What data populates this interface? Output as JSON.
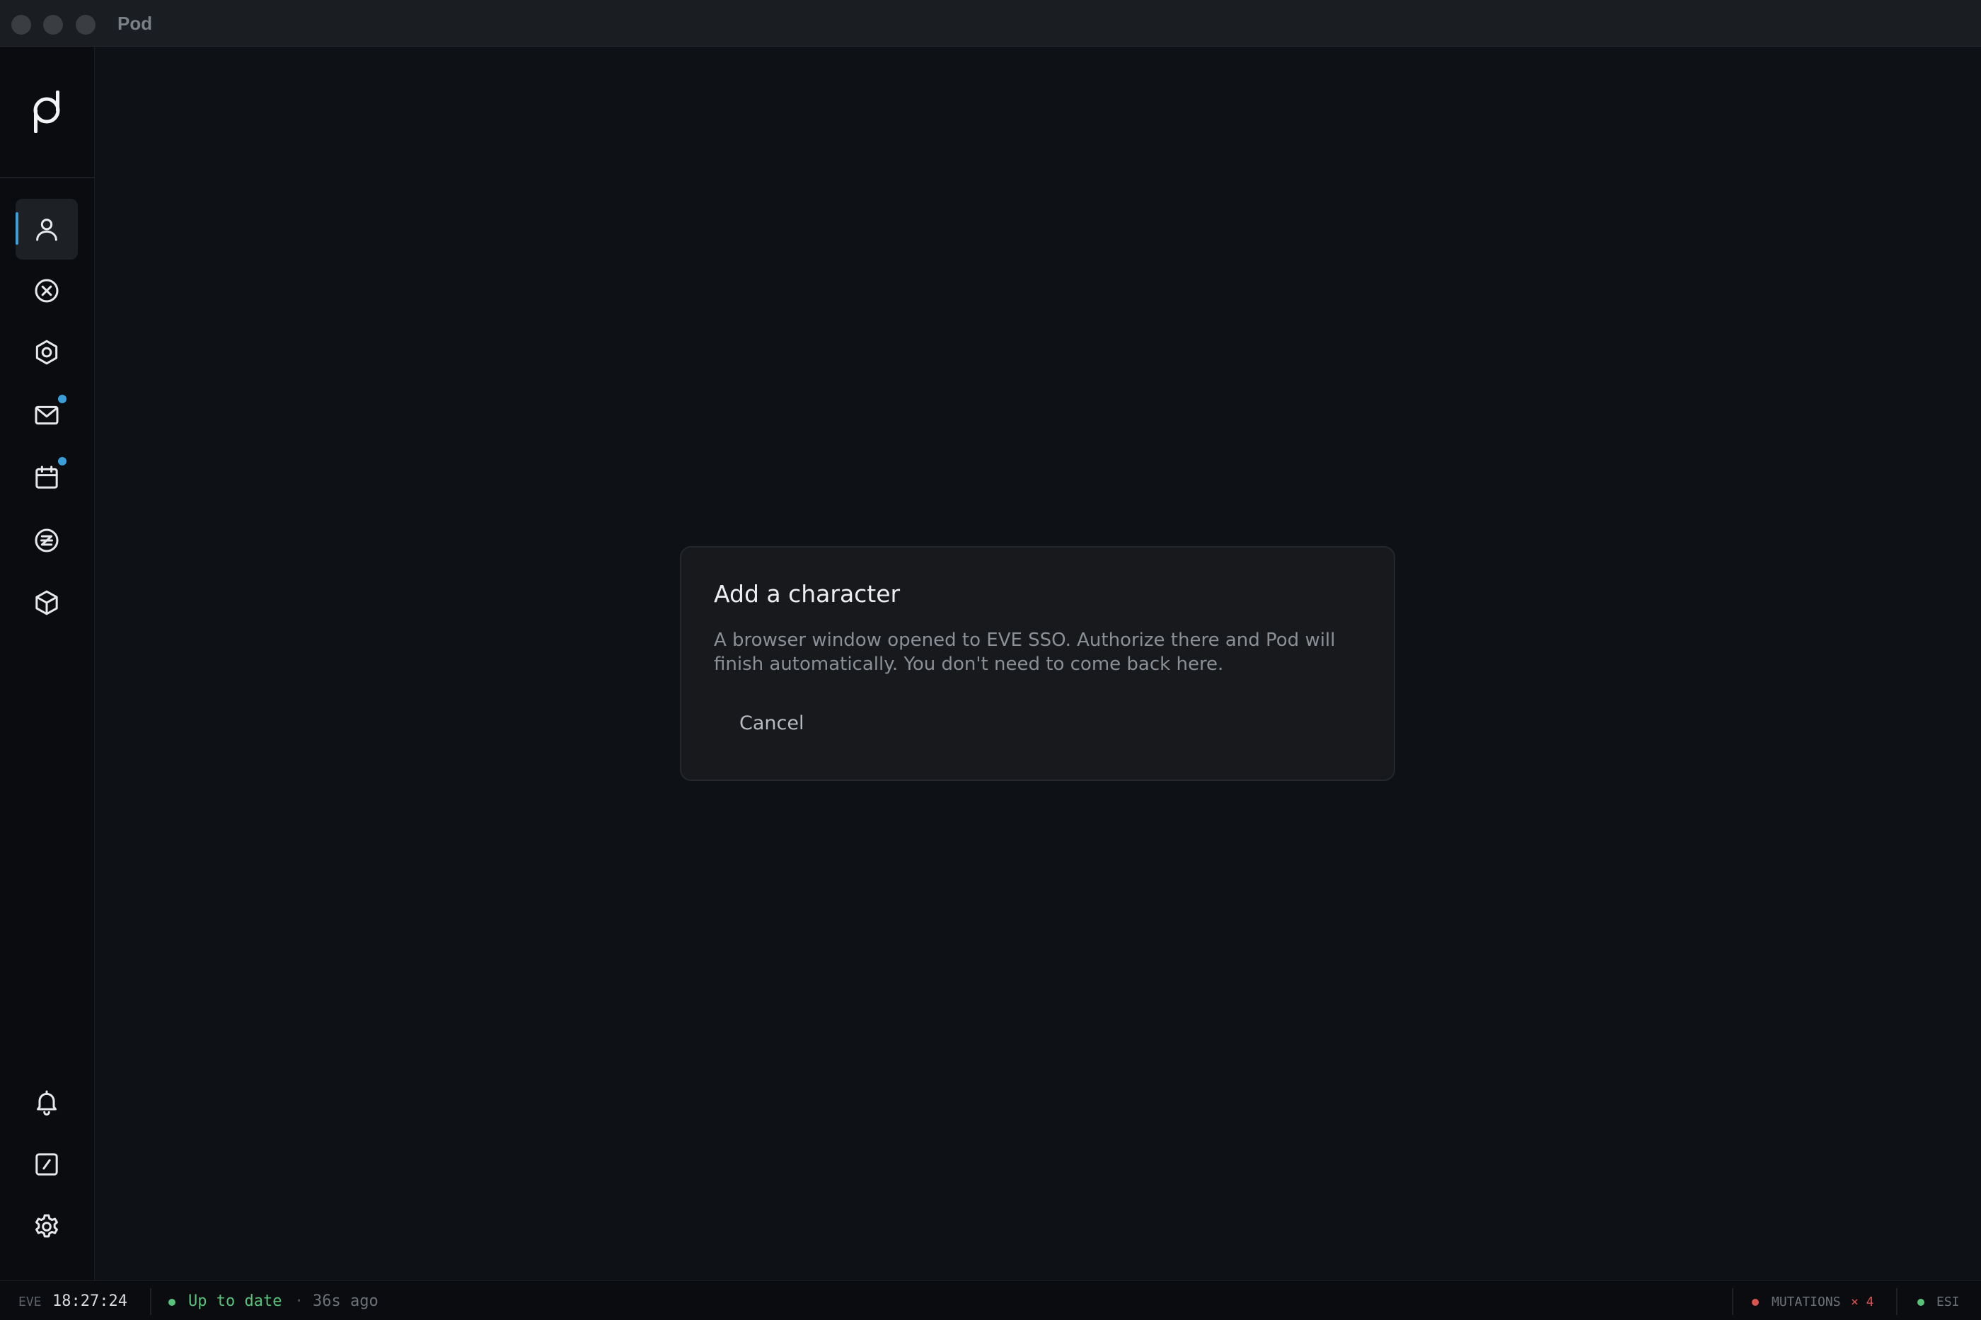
{
  "window": {
    "title": "Pod"
  },
  "sidebar": {
    "items": [
      {
        "id": "characters",
        "icon": "user-icon",
        "active": true,
        "badge": false
      },
      {
        "id": "item-2",
        "icon": "circle-x-icon",
        "active": false,
        "badge": false
      },
      {
        "id": "item-3",
        "icon": "hexagon-icon",
        "active": false,
        "badge": false
      },
      {
        "id": "mail",
        "icon": "mail-icon",
        "active": false,
        "badge": true
      },
      {
        "id": "calendar",
        "icon": "calendar-icon",
        "active": false,
        "badge": true
      },
      {
        "id": "item-6",
        "icon": "circle-z-icon",
        "active": false,
        "badge": false
      },
      {
        "id": "item-7",
        "icon": "cube-icon",
        "active": false,
        "badge": false
      }
    ],
    "bottom_items": [
      {
        "id": "notifications",
        "icon": "bell-icon"
      },
      {
        "id": "item-slash",
        "icon": "slash-square-icon"
      },
      {
        "id": "settings",
        "icon": "gear-icon"
      }
    ],
    "accent_color": "#3a9fd9"
  },
  "dialog": {
    "title": "Add a character",
    "body": "A browser window opened to EVE SSO. Authorize there and Pod will finish automatically. You don't need to come back here.",
    "cancel_label": "Cancel"
  },
  "statusbar": {
    "eve_label": "EVE",
    "clock": "18:27:24",
    "status_text": "Up to date",
    "separator": "·",
    "ago": "36s ago",
    "mutations_label": "MUTATIONS",
    "mutations_count": "× 4",
    "esi_label": "ESI",
    "status_color": "#56c27a",
    "mutations_color": "#d9534f"
  }
}
